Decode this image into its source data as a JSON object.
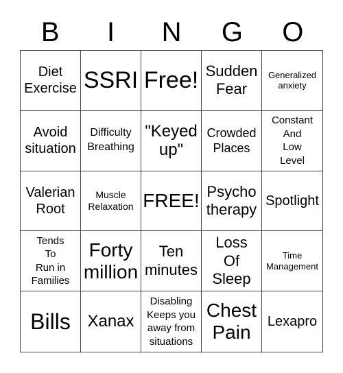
{
  "header": {
    "letters": [
      "B",
      "I",
      "N",
      "G",
      "O"
    ]
  },
  "cells": [
    {
      "text": "Diet\nExercise",
      "size": "s20"
    },
    {
      "text": "SSRI",
      "size": "s34"
    },
    {
      "text": "Free!",
      "size": "s34"
    },
    {
      "text": "Sudden\nFear",
      "size": "s22"
    },
    {
      "text": "Generalized\nanxiety",
      "size": "s13"
    },
    {
      "text": "Avoid\nsituation",
      "size": "s20"
    },
    {
      "text": "Difficulty\nBreathing",
      "size": "s16"
    },
    {
      "text": "\"Keyed\nup\"",
      "size": "s24"
    },
    {
      "text": "Crowded\nPlaces",
      "size": "s18"
    },
    {
      "text": "Constant\nAnd\nLow\nLevel",
      "size": "s15"
    },
    {
      "text": "Valerian\nRoot",
      "size": "s20"
    },
    {
      "text": "Muscle\nRelaxation",
      "size": "s14"
    },
    {
      "text": "FREE!",
      "size": "s28"
    },
    {
      "text": "Psycho\ntherapy",
      "size": "s22"
    },
    {
      "text": "Spotlight",
      "size": "s20"
    },
    {
      "text": "Tends\nTo\nRun in\nFamilies",
      "size": "s15"
    },
    {
      "text": "Forty\nmillion",
      "size": "s28"
    },
    {
      "text": "Ten\nminutes",
      "size": "s22"
    },
    {
      "text": "Loss\nOf\nSleep",
      "size": "s22"
    },
    {
      "text": "Time\nManagement",
      "size": "s13"
    },
    {
      "text": "Bills",
      "size": "s32"
    },
    {
      "text": "Xanax",
      "size": "s24"
    },
    {
      "text": "Disabling\nKeeps you\naway from\nsituations",
      "size": "s15"
    },
    {
      "text": "Chest\nPain",
      "size": "s28"
    },
    {
      "text": "Lexapro",
      "size": "s20"
    }
  ]
}
